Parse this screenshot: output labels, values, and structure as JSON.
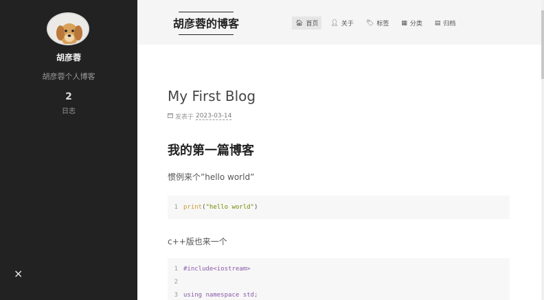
{
  "sidebar": {
    "author": "胡彦蓉",
    "description": "胡彦蓉个人博客",
    "stat_count": "2",
    "stat_label": "日志",
    "close_label": "×"
  },
  "header": {
    "brand": "胡彦蓉的博客",
    "nav": [
      {
        "label": "首页",
        "icon": "home-icon",
        "glyph": "🏠︎"
      },
      {
        "label": "关于",
        "icon": "user-icon",
        "glyph": "👤︎"
      },
      {
        "label": "标签",
        "icon": "tag-icon",
        "glyph": "🏷︎"
      },
      {
        "label": "分类",
        "icon": "grid-icon",
        "glyph": "▦"
      },
      {
        "label": "归档",
        "icon": "archive-icon",
        "glyph": "▤"
      }
    ]
  },
  "post": {
    "title": "My First Blog",
    "meta_prefix": "发表于",
    "date": "2023-03-14",
    "heading": "我的第一篇博客",
    "para1": "惯例来个”hello world”",
    "code1": [
      {
        "ln": "1",
        "fn": "print",
        "open": "(",
        "str": "\"hello world\"",
        "close": ")"
      }
    ],
    "para2": "c++版也来一个",
    "code2": [
      {
        "ln": "1",
        "text": "#include<iostream>"
      },
      {
        "ln": "2",
        "text": ""
      },
      {
        "ln": "3",
        "text": "using namespace std;"
      }
    ]
  },
  "colors": {
    "sidebar_bg": "#222222",
    "header_bg": "#f5f5f5",
    "code_bg": "#f7f7f7"
  }
}
